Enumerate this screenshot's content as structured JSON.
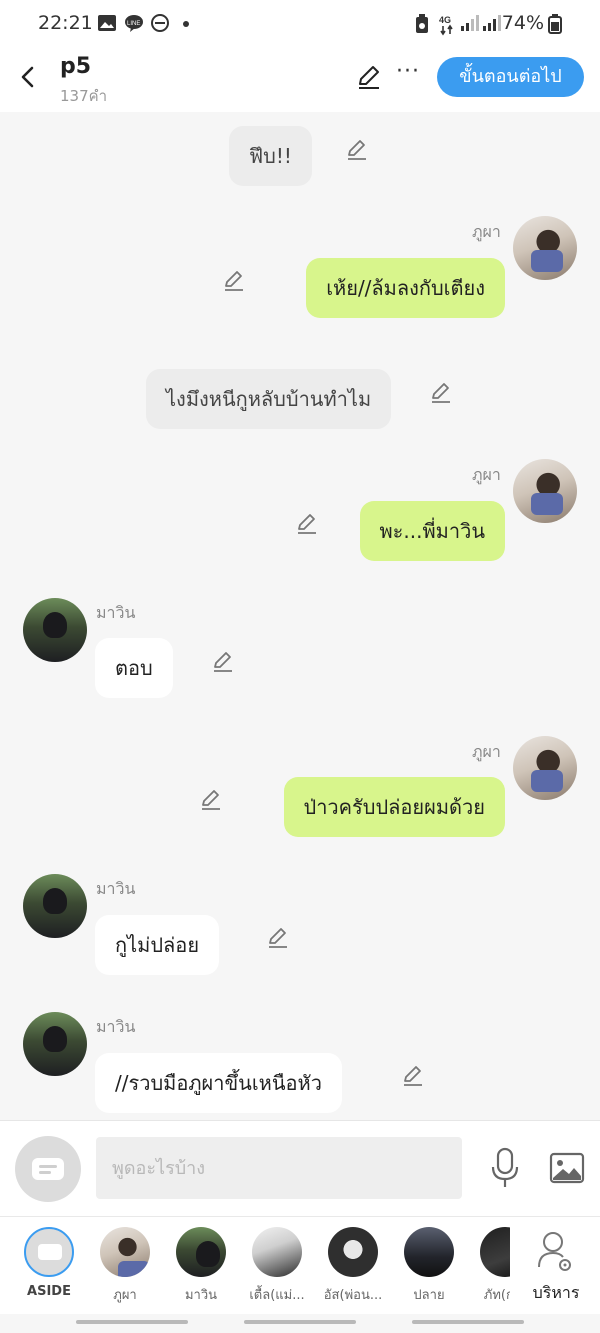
{
  "status_bar": {
    "time": "22:21",
    "battery": "74%",
    "network": "4G"
  },
  "header": {
    "title": "p5",
    "subtitle": "137คำ",
    "next_label": "ขั้นตอนต่อไป"
  },
  "messages": [
    {
      "type": "narration",
      "text": "ฟึบ!!"
    },
    {
      "type": "right",
      "speaker": "ภูผา",
      "text": "เห้ย//ล้มลงกับเตียง"
    },
    {
      "type": "narration",
      "text": "ไงมึงหนีกูหลับบ้านทำไม"
    },
    {
      "type": "right",
      "speaker": "ภูผา",
      "text": "พะ...พี่มาวิน"
    },
    {
      "type": "left",
      "speaker": "มาวิน",
      "text": "ตอบ"
    },
    {
      "type": "right",
      "speaker": "ภูผา",
      "text": "ป่าวครับปล่อยผมด้วย"
    },
    {
      "type": "left",
      "speaker": "มาวิน",
      "text": "กูไม่ปล่อย"
    },
    {
      "type": "left",
      "speaker": "มาวิน",
      "text": "//รวบมือภูผาขึ้นเหนือหัว"
    }
  ],
  "input": {
    "placeholder": "พูดอะไรบ้าง"
  },
  "characters": [
    {
      "name": "ASIDE"
    },
    {
      "name": "ภูผา"
    },
    {
      "name": "มาวิน"
    },
    {
      "name": "เตื้ล(แม่..."
    },
    {
      "name": "อัส(พ่อน..."
    },
    {
      "name": "ปลาย"
    },
    {
      "name": "ภัท(ก..."
    }
  ],
  "manage_label": "บริหาร",
  "colors": {
    "accent": "#3b9cf0",
    "right_bubble": "#d8f58c",
    "narration_bubble": "#ececec"
  }
}
